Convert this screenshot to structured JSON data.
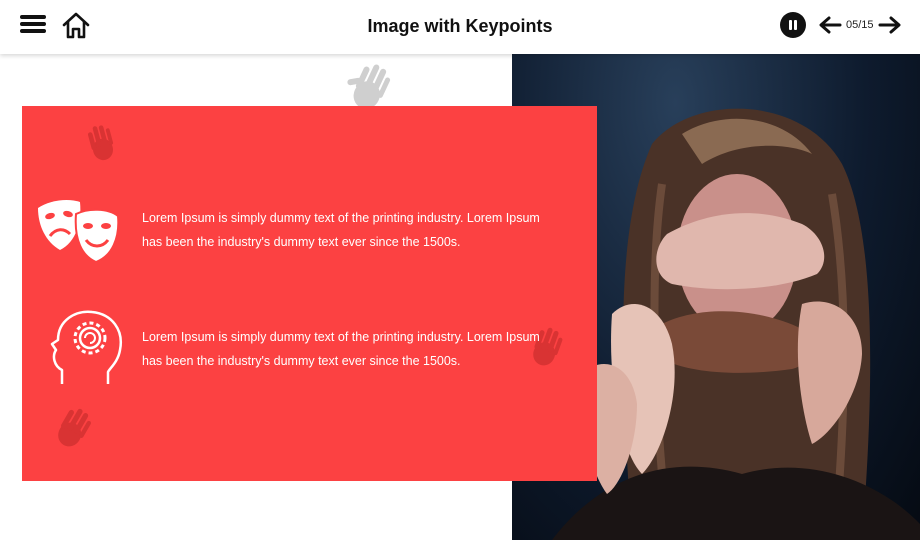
{
  "header": {
    "title": "Image with Keypoints",
    "page_counter": "05/15",
    "icons": [
      "menu-icon",
      "home-icon",
      "pause-icon",
      "arrow-left-icon",
      "arrow-right-icon"
    ]
  },
  "keypoints": [
    {
      "icon": "theater-masks-icon",
      "text": "Lorem Ipsum is simply dummy text of the printing industry. Lorem Ipsum has been the industry's dummy text ever since the 1500s."
    },
    {
      "icon": "head-gear-icon",
      "text": "Lorem Ipsum is simply dummy text of the printing industry. Lorem Ipsum has been the industry's dummy text ever since the 1500s."
    }
  ],
  "colors": {
    "card": "#fc4142",
    "header_bg": "#ffffff",
    "text_light": "#ffffff",
    "text_dark": "#111111"
  }
}
